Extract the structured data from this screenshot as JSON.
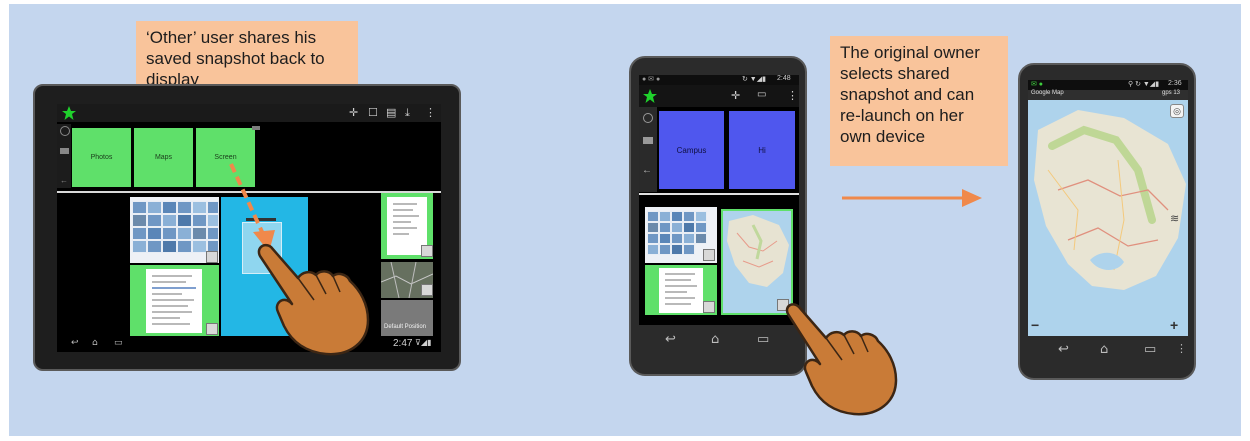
{
  "callouts": {
    "left_text": "‘Other’ user shares his saved snapshot back to display",
    "right_text": "The original owner selects shared snapshot and can re-launch on her own device"
  },
  "tablet": {
    "tiles": [
      {
        "label": "Photos"
      },
      {
        "label": "Maps"
      },
      {
        "label": "Screen"
      }
    ],
    "status_time": "2:47",
    "default_position_label": "Default Position"
  },
  "phone_left": {
    "status_time": "2:48",
    "tiles": [
      {
        "label": "Campus"
      },
      {
        "label": "Hi"
      }
    ]
  },
  "phone_right": {
    "status_time": "2:36",
    "app_title": "Google Map",
    "gps_label": "gps 13"
  },
  "colors": {
    "background": "#c4d6ee",
    "callout": "#f9c49b",
    "arrow": "#f0894b",
    "hand": "#c97b37",
    "tile_green": "#5fe06a",
    "tile_blue": "#4f57ee",
    "highlight_cyan": "#23b7e5"
  },
  "icons": [
    "star-icon",
    "move-icon",
    "window-icon",
    "list-icon",
    "download-icon",
    "more-icon",
    "back-nav-icon",
    "home-nav-icon",
    "recents-nav-icon",
    "layers-icon",
    "compass-icon",
    "zoom-in-icon",
    "zoom-out-icon",
    "pointing-hand-icon",
    "arrow-icon"
  ]
}
